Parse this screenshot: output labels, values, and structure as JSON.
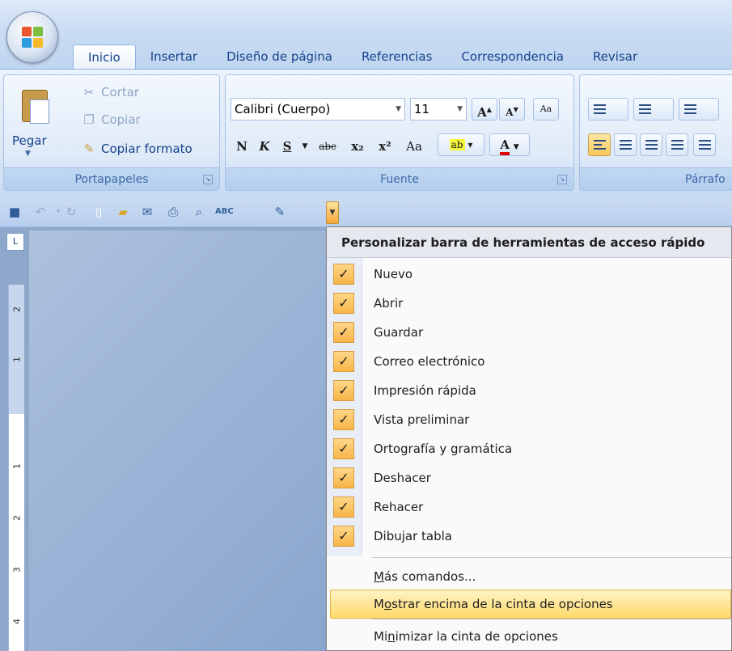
{
  "tabs": [
    "Inicio",
    "Insertar",
    "Diseño de página",
    "Referencias",
    "Correspondencia",
    "Revisar"
  ],
  "clipboard": {
    "paste": "Pegar",
    "cut": "Cortar",
    "copy": "Copiar",
    "format_painter": "Copiar formato",
    "group_label": "Portapapeles"
  },
  "font": {
    "font_name": "Calibri (Cuerpo)",
    "font_size": "11",
    "group_label": "Fuente",
    "buttons": [
      "N",
      "K",
      "S",
      "abc",
      "x₂",
      "x²",
      "Aa"
    ]
  },
  "paragraph": {
    "group_label": "Párrafo"
  },
  "qat_icons": [
    "save-icon",
    "undo-icon",
    "redo-icon",
    "new-icon",
    "open-icon",
    "email-icon",
    "quick-print-icon",
    "print-preview-icon",
    "spelling-icon",
    "draw-table-icon"
  ],
  "ruler_corner": "L",
  "ruler_marks": [
    "2",
    "1",
    "1",
    "2",
    "3",
    "4"
  ],
  "menu": {
    "header": "Personalizar barra de herramientas de acceso rápido",
    "items": [
      {
        "label": "Nuevo",
        "checked": true
      },
      {
        "label": "Abrir",
        "checked": true
      },
      {
        "label": "Guardar",
        "checked": true
      },
      {
        "label": "Correo electrónico",
        "checked": true
      },
      {
        "label": "Impresión rápida",
        "checked": true
      },
      {
        "label": "Vista preliminar",
        "checked": true
      },
      {
        "label": "Ortografía y gramática",
        "checked": true
      },
      {
        "label": "Deshacer",
        "checked": true
      },
      {
        "label": "Rehacer",
        "checked": true
      },
      {
        "label": "Dibujar tabla",
        "checked": true
      }
    ],
    "more_commands": {
      "prefix": "",
      "accel": "M",
      "rest": "ás comandos..."
    },
    "show_above": {
      "prefix": "M",
      "accel": "o",
      "rest": "strar encima de la cinta de opciones"
    },
    "minimize": {
      "prefix": "Mi",
      "accel": "n",
      "rest": "imizar la cinta de opciones"
    },
    "check_glyph": "✓"
  },
  "colors": {
    "ribbon_text": "#15428b",
    "highlight": "#ffd96a",
    "check_bg": "#f7b548"
  }
}
